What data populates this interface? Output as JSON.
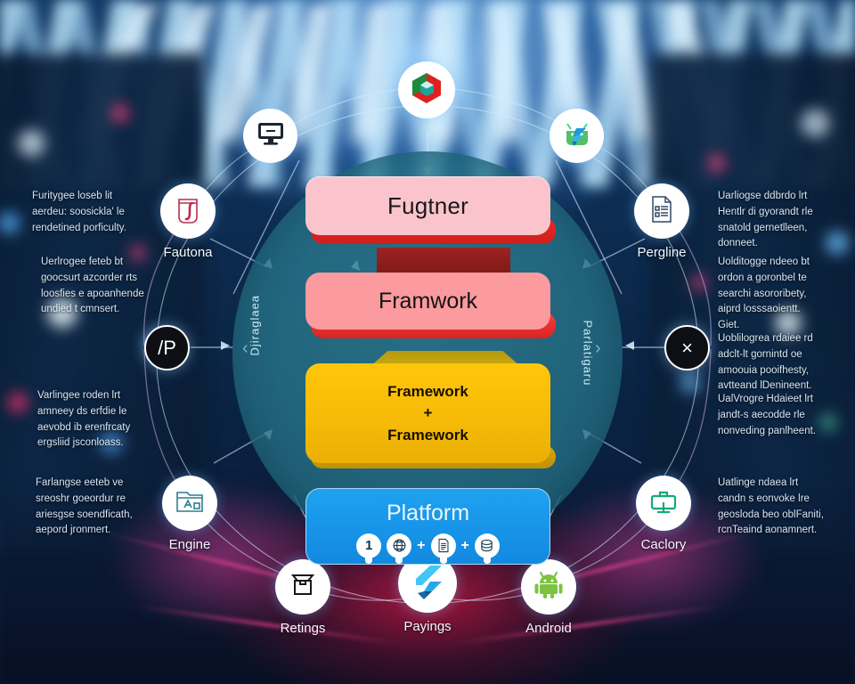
{
  "diagram": {
    "title": "Layered framework architecture wheel",
    "core": {
      "side_label_left": "Djiraglaea",
      "side_label_right": "Parlatigaru",
      "chevron_left": "‹",
      "chevron_right": "›"
    },
    "layers": [
      {
        "id": "layer-fugtner",
        "label": "Fugtner",
        "color": "#fbc4cd",
        "edge_color": "#ea2a27"
      },
      {
        "id": "layer-framwork",
        "label": "Framwork",
        "color": "#fb9a9f",
        "edge_color": "#f6403c"
      },
      {
        "id": "layer-framework-combo",
        "line1": "Framework",
        "plus": "+",
        "line2": "Framework",
        "color": "#ffc60b",
        "edge_color": "#d9a406"
      },
      {
        "id": "layer-platform",
        "label": "Platform",
        "color": "#1794e8",
        "edge_color": "#0f7ac6"
      }
    ],
    "platform_chips": [
      {
        "icon": "number-one-icon",
        "text": "1"
      },
      {
        "icon": "globe-network-icon",
        "text": ""
      },
      {
        "icon": "document-list-icon",
        "text": ""
      },
      {
        "icon": "database-stack-icon",
        "text": ""
      }
    ],
    "chip_separator": "+",
    "nodes": [
      {
        "id": "node-cube",
        "icon": "hexagon-cube-icon",
        "label": "",
        "style": "light"
      },
      {
        "id": "node-monitor",
        "icon": "desktop-monitor-icon",
        "label": "",
        "style": "light"
      },
      {
        "id": "node-droid-f",
        "icon": "android-flutter-icon",
        "label": "",
        "style": "light"
      },
      {
        "id": "node-fautona",
        "icon": "script-f-icon",
        "label": "Fautona",
        "style": "light"
      },
      {
        "id": "node-pergline",
        "icon": "document-checklist-icon",
        "label": "Pergline",
        "style": "light"
      },
      {
        "id": "node-slash-p",
        "icon": "slash-p-icon",
        "label": "",
        "style": "dark",
        "glyph": "/P"
      },
      {
        "id": "node-close-x",
        "icon": "close-x-icon",
        "label": "",
        "style": "dark",
        "glyph": "×"
      },
      {
        "id": "node-engine",
        "icon": "folder-window-a-icon",
        "label": "Engine",
        "style": "light"
      },
      {
        "id": "node-caclory",
        "icon": "toolbox-briefcase-icon",
        "label": "Caclory",
        "style": "light"
      },
      {
        "id": "node-retings",
        "icon": "open-box-icon",
        "label": "Retings",
        "style": "light"
      },
      {
        "id": "node-payings",
        "icon": "flutter-logo-icon",
        "label": "Payings",
        "style": "light"
      },
      {
        "id": "node-android",
        "icon": "android-robot-icon",
        "label": "Android",
        "style": "light"
      }
    ],
    "notes_left": [
      {
        "id": "note-left-1",
        "lines": [
          "Furitygee loseb lit",
          "aerdeu: soosickla' le",
          "rendetined porficulty."
        ]
      },
      {
        "id": "note-left-2",
        "lines": [
          "Uerlrogee feteb bt",
          "goocsurt azcorder rts",
          "loosfies e apoanhende",
          "undied t cmnsert."
        ]
      },
      {
        "id": "note-left-3",
        "lines": [
          "Varlingee roden lrt",
          "amneey ds erfdie le",
          "aevobd ib erenfrcaty",
          "ergsliid jsconloass."
        ]
      },
      {
        "id": "note-left-4",
        "lines": [
          "Farlangse eeteb ve",
          "sreoshr goeordur re",
          "ariesgse soendficath,",
          "aepord jronmert."
        ]
      }
    ],
    "notes_right": [
      {
        "id": "note-right-1",
        "lines": [
          "Uarliogse ddbrdo lrt",
          "Hentlr di gyorandt rle",
          "snatold gernetlleen,",
          "donneet."
        ]
      },
      {
        "id": "note-right-2",
        "lines": [
          "Uolditogge ndeeo bt",
          "ordon a goronbel te",
          "searchi asororibety,",
          "aiprd losssaoientt.",
          "Giet."
        ]
      },
      {
        "id": "note-right-3",
        "lines": [
          "Uoblilogrea rdaiee rd",
          "adclt-lt gornintd oe",
          "amoouia pooifhesty,",
          "avtteand lDenineent."
        ]
      },
      {
        "id": "note-right-4",
        "lines": [
          "UalVrogre Hdaieet lrt",
          "jandt-s aecodde rle",
          "nonveding panlheent."
        ]
      },
      {
        "id": "note-right-5",
        "lines": [
          "Uatlinge ndaea lrt",
          "candn s eonvoke lre",
          "geosloda beo oblFaniti,",
          "rcnTeaind aonamnert."
        ]
      }
    ]
  }
}
